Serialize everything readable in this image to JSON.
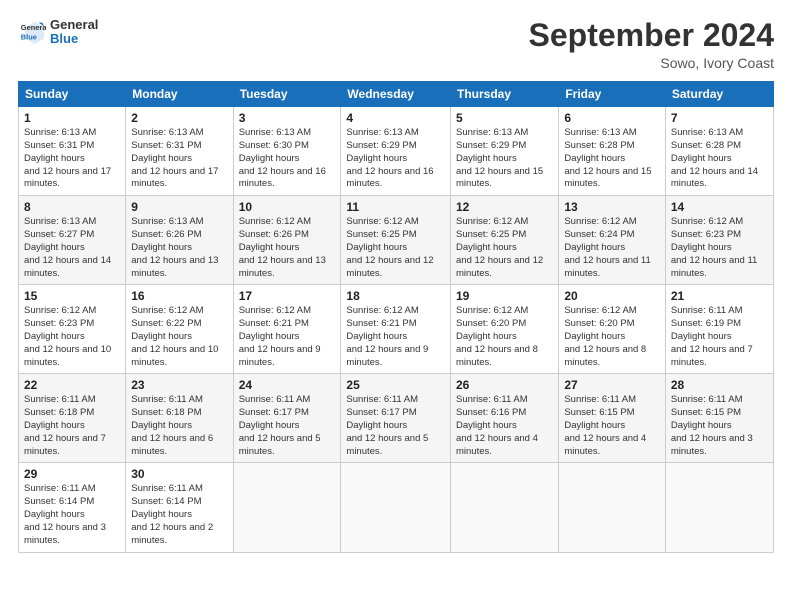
{
  "header": {
    "logo_general": "General",
    "logo_blue": "Blue",
    "month_title": "September 2024",
    "location": "Sowo, Ivory Coast"
  },
  "days_of_week": [
    "Sunday",
    "Monday",
    "Tuesday",
    "Wednesday",
    "Thursday",
    "Friday",
    "Saturday"
  ],
  "weeks": [
    [
      {
        "num": "1",
        "sunrise": "6:13 AM",
        "sunset": "6:31 PM",
        "daylight": "12 hours and 17 minutes."
      },
      {
        "num": "2",
        "sunrise": "6:13 AM",
        "sunset": "6:31 PM",
        "daylight": "12 hours and 17 minutes."
      },
      {
        "num": "3",
        "sunrise": "6:13 AM",
        "sunset": "6:30 PM",
        "daylight": "12 hours and 16 minutes."
      },
      {
        "num": "4",
        "sunrise": "6:13 AM",
        "sunset": "6:29 PM",
        "daylight": "12 hours and 16 minutes."
      },
      {
        "num": "5",
        "sunrise": "6:13 AM",
        "sunset": "6:29 PM",
        "daylight": "12 hours and 15 minutes."
      },
      {
        "num": "6",
        "sunrise": "6:13 AM",
        "sunset": "6:28 PM",
        "daylight": "12 hours and 15 minutes."
      },
      {
        "num": "7",
        "sunrise": "6:13 AM",
        "sunset": "6:28 PM",
        "daylight": "12 hours and 14 minutes."
      }
    ],
    [
      {
        "num": "8",
        "sunrise": "6:13 AM",
        "sunset": "6:27 PM",
        "daylight": "12 hours and 14 minutes."
      },
      {
        "num": "9",
        "sunrise": "6:13 AM",
        "sunset": "6:26 PM",
        "daylight": "12 hours and 13 minutes."
      },
      {
        "num": "10",
        "sunrise": "6:12 AM",
        "sunset": "6:26 PM",
        "daylight": "12 hours and 13 minutes."
      },
      {
        "num": "11",
        "sunrise": "6:12 AM",
        "sunset": "6:25 PM",
        "daylight": "12 hours and 12 minutes."
      },
      {
        "num": "12",
        "sunrise": "6:12 AM",
        "sunset": "6:25 PM",
        "daylight": "12 hours and 12 minutes."
      },
      {
        "num": "13",
        "sunrise": "6:12 AM",
        "sunset": "6:24 PM",
        "daylight": "12 hours and 11 minutes."
      },
      {
        "num": "14",
        "sunrise": "6:12 AM",
        "sunset": "6:23 PM",
        "daylight": "12 hours and 11 minutes."
      }
    ],
    [
      {
        "num": "15",
        "sunrise": "6:12 AM",
        "sunset": "6:23 PM",
        "daylight": "12 hours and 10 minutes."
      },
      {
        "num": "16",
        "sunrise": "6:12 AM",
        "sunset": "6:22 PM",
        "daylight": "12 hours and 10 minutes."
      },
      {
        "num": "17",
        "sunrise": "6:12 AM",
        "sunset": "6:21 PM",
        "daylight": "12 hours and 9 minutes."
      },
      {
        "num": "18",
        "sunrise": "6:12 AM",
        "sunset": "6:21 PM",
        "daylight": "12 hours and 9 minutes."
      },
      {
        "num": "19",
        "sunrise": "6:12 AM",
        "sunset": "6:20 PM",
        "daylight": "12 hours and 8 minutes."
      },
      {
        "num": "20",
        "sunrise": "6:12 AM",
        "sunset": "6:20 PM",
        "daylight": "12 hours and 8 minutes."
      },
      {
        "num": "21",
        "sunrise": "6:11 AM",
        "sunset": "6:19 PM",
        "daylight": "12 hours and 7 minutes."
      }
    ],
    [
      {
        "num": "22",
        "sunrise": "6:11 AM",
        "sunset": "6:18 PM",
        "daylight": "12 hours and 7 minutes."
      },
      {
        "num": "23",
        "sunrise": "6:11 AM",
        "sunset": "6:18 PM",
        "daylight": "12 hours and 6 minutes."
      },
      {
        "num": "24",
        "sunrise": "6:11 AM",
        "sunset": "6:17 PM",
        "daylight": "12 hours and 5 minutes."
      },
      {
        "num": "25",
        "sunrise": "6:11 AM",
        "sunset": "6:17 PM",
        "daylight": "12 hours and 5 minutes."
      },
      {
        "num": "26",
        "sunrise": "6:11 AM",
        "sunset": "6:16 PM",
        "daylight": "12 hours and 4 minutes."
      },
      {
        "num": "27",
        "sunrise": "6:11 AM",
        "sunset": "6:15 PM",
        "daylight": "12 hours and 4 minutes."
      },
      {
        "num": "28",
        "sunrise": "6:11 AM",
        "sunset": "6:15 PM",
        "daylight": "12 hours and 3 minutes."
      }
    ],
    [
      {
        "num": "29",
        "sunrise": "6:11 AM",
        "sunset": "6:14 PM",
        "daylight": "12 hours and 3 minutes."
      },
      {
        "num": "30",
        "sunrise": "6:11 AM",
        "sunset": "6:14 PM",
        "daylight": "12 hours and 2 minutes."
      },
      null,
      null,
      null,
      null,
      null
    ]
  ]
}
